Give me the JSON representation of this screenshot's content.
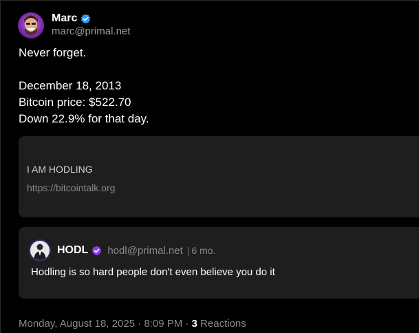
{
  "post": {
    "author_name": "Marc",
    "author_handle": "marc@primal.net",
    "text": "Never forget.\n\nDecember 18, 2013\nBitcoin price: $522.70\nDown 22.9% for that day.",
    "verified_color": "#2e9cf4"
  },
  "link_preview": {
    "title": "I AM HODLING",
    "url": "https://bitcointalk.org"
  },
  "quoted_note": {
    "author_name": "HODL",
    "author_handle": "hodl@primal.net",
    "separator": "|",
    "time": "6 mo.",
    "text": "Hodling is so hard people don't even believe you do it",
    "verified_color": "#8a3ff0"
  },
  "footer": {
    "timestamp": "Monday, August 18, 2025 · 8:09 PM · ",
    "reactions_count": "3",
    "reactions_label": " Reactions"
  }
}
